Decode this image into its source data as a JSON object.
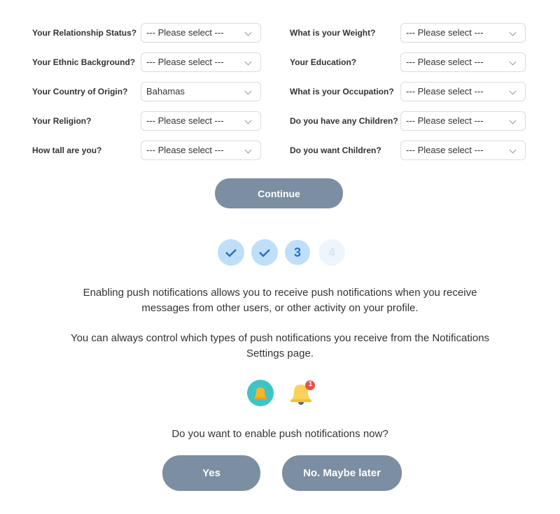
{
  "form": {
    "left": [
      {
        "label": "Your Relationship Status?",
        "value": "--- Please select ---"
      },
      {
        "label": "Your Ethnic Background?",
        "value": "--- Please select ---"
      },
      {
        "label": "Your Country of Origin?",
        "value": "Bahamas"
      },
      {
        "label": "Your Religion?",
        "value": "--- Please select ---"
      },
      {
        "label": "How tall are you?",
        "value": "--- Please select ---"
      }
    ],
    "right": [
      {
        "label": "What is your Weight?",
        "value": "--- Please select ---"
      },
      {
        "label": "Your Education?",
        "value": "--- Please select ---"
      },
      {
        "label": "What is your Occupation?",
        "value": "--- Please select ---"
      },
      {
        "label": "Do you have any Children?",
        "value": "--- Please select ---"
      },
      {
        "label": "Do you want Children?",
        "value": "--- Please select ---"
      }
    ],
    "continue_label": "Continue"
  },
  "steps": [
    {
      "state": "done",
      "label": ""
    },
    {
      "state": "done",
      "label": ""
    },
    {
      "state": "current",
      "label": "3"
    },
    {
      "state": "upcoming",
      "label": "4"
    }
  ],
  "notifications": {
    "para1_line1": "Enabling push notifications allows you to receive push notifications when you receive",
    "para1_line2": "messages from other users, or other activity on your profile.",
    "para2_line1": "You can always control which types of push notifications you receive from the Notifications",
    "para2_line2": "Settings page.",
    "badge_count": "1",
    "question": "Do you want to enable push notifications now?",
    "yes_label": "Yes",
    "no_label": "No. Maybe later"
  },
  "colors": {
    "button": "#7b8ea2",
    "step": "#bfdff9",
    "step_text": "#2a6fc1"
  }
}
